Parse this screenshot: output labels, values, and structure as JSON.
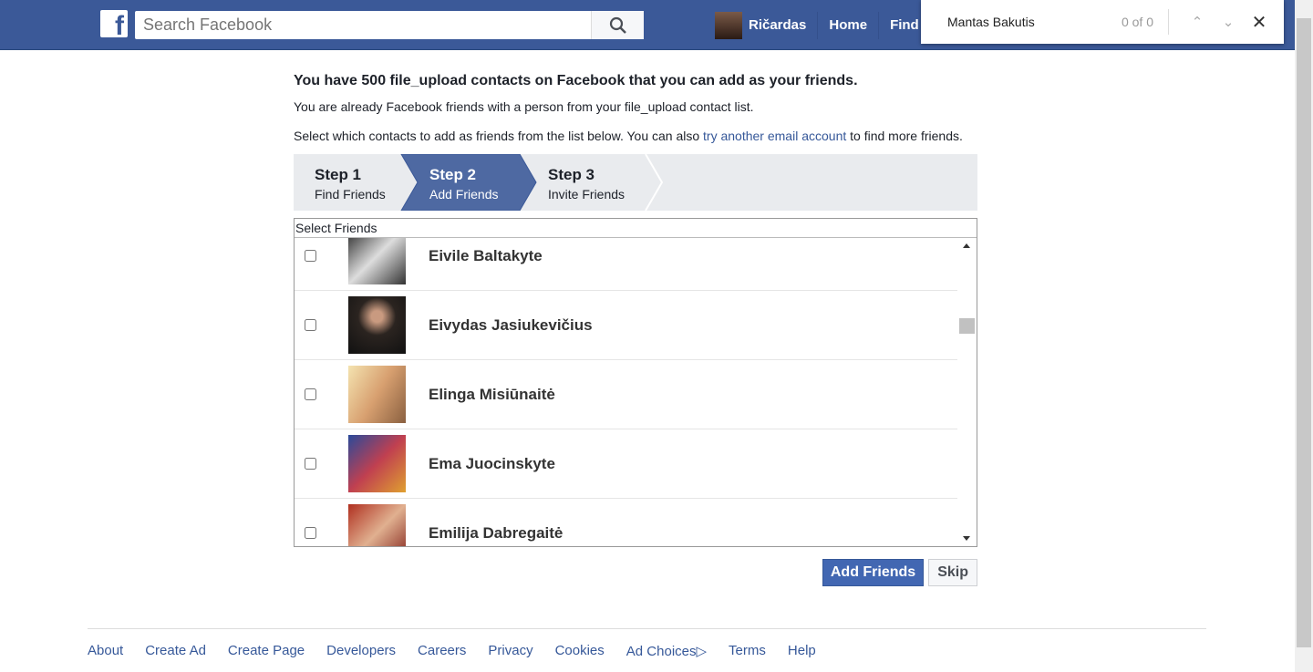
{
  "header": {
    "logo": "f",
    "search_placeholder": "Search Facebook",
    "user": "Ričardas",
    "nav": [
      "Home",
      "Find Fr"
    ]
  },
  "find_bar": {
    "query": "Mantas Bakutis",
    "count": "0 of 0"
  },
  "main": {
    "title": "You have 500 file_upload contacts on Facebook that you can add as your friends.",
    "line1": "You are already Facebook friends with a person from your file_upload contact list.",
    "line2_pre": "Select which contacts to add as friends from the list below. You can also ",
    "line2_link": "try another email account",
    "line2_post": " to find more friends.",
    "steps": [
      {
        "title": "Step 1",
        "label": "Find Friends"
      },
      {
        "title": "Step 2",
        "label": "Add Friends",
        "active": true
      },
      {
        "title": "Step 3",
        "label": "Invite Friends"
      }
    ],
    "list_header": "Select Friends",
    "friends": [
      {
        "name": "Eivile Baltakyte",
        "checked": false
      },
      {
        "name": "Eivydas Jasiukevičius",
        "checked": false
      },
      {
        "name": "Elinga Misiūnaitė",
        "checked": false
      },
      {
        "name": "Ema Juocinskyte",
        "checked": false
      },
      {
        "name": "Emilija Dabregaitė",
        "checked": false
      }
    ],
    "add_button": "Add Friends",
    "skip_button": "Skip"
  },
  "footer": [
    "About",
    "Create Ad",
    "Create Page",
    "Developers",
    "Careers",
    "Privacy",
    "Cookies",
    "Ad Choices",
    "Terms",
    "Help"
  ],
  "colors": {
    "brand": "#3b5998",
    "button": "#4267b2",
    "link": "#365899"
  }
}
